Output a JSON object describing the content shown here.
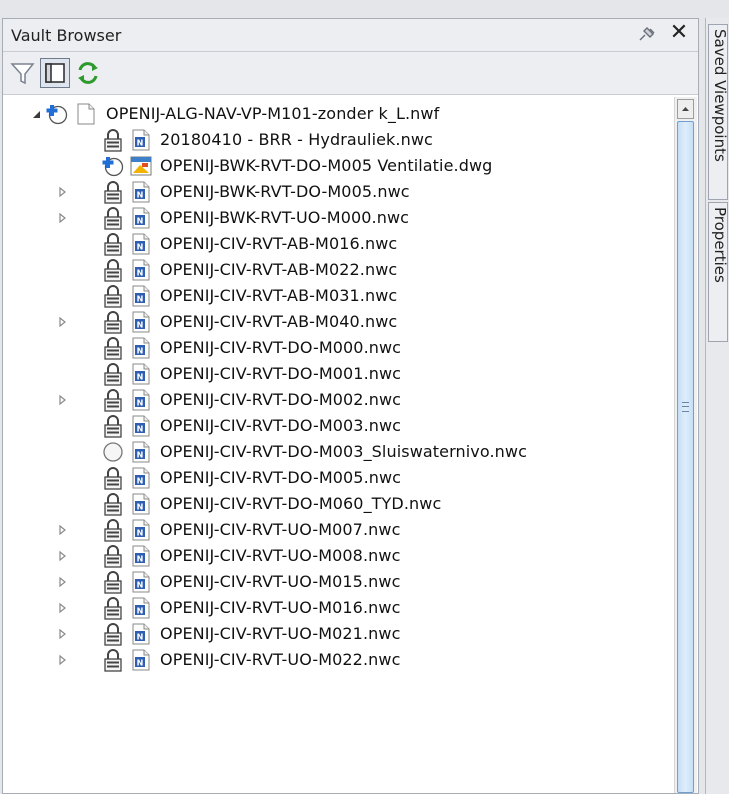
{
  "panel": {
    "title": "Vault Browser",
    "pin_icon": "pin-icon",
    "close_label": "✕"
  },
  "toolbar": {
    "buttons": [
      {
        "icon": "filter-icon",
        "pressed": false
      },
      {
        "icon": "panel-layout-icon",
        "pressed": true
      },
      {
        "icon": "refresh-icon",
        "pressed": false
      }
    ]
  },
  "side_tabs": [
    "Saved Viewpoints",
    "Properties"
  ],
  "tree": {
    "root": {
      "label": "OPENIJ-ALG-NAV-VP-M101-zonder k_L.nwf",
      "expanded": true,
      "status": "checked-out",
      "type": "nwf"
    },
    "items": [
      {
        "label": "20180410 - BRR - Hydrauliek.nwc",
        "status": "locked",
        "type": "nwc",
        "expandable": false
      },
      {
        "label": "OPENIJ-BWK-RVT-DO-M005 Ventilatie.dwg",
        "status": "checked-out",
        "type": "dwg",
        "expandable": false
      },
      {
        "label": "OPENIJ-BWK-RVT-DO-M005.nwc",
        "status": "locked",
        "type": "nwc",
        "expandable": true
      },
      {
        "label": "OPENIJ-BWK-RVT-UO-M000.nwc",
        "status": "locked",
        "type": "nwc",
        "expandable": true
      },
      {
        "label": "OPENIJ-CIV-RVT-AB-M016.nwc",
        "status": "locked",
        "type": "nwc",
        "expandable": false
      },
      {
        "label": "OPENIJ-CIV-RVT-AB-M022.nwc",
        "status": "locked",
        "type": "nwc",
        "expandable": false
      },
      {
        "label": "OPENIJ-CIV-RVT-AB-M031.nwc",
        "status": "locked",
        "type": "nwc",
        "expandable": false
      },
      {
        "label": "OPENIJ-CIV-RVT-AB-M040.nwc",
        "status": "locked",
        "type": "nwc",
        "expandable": true
      },
      {
        "label": "OPENIJ-CIV-RVT-DO-M000.nwc",
        "status": "locked",
        "type": "nwc",
        "expandable": false
      },
      {
        "label": "OPENIJ-CIV-RVT-DO-M001.nwc",
        "status": "locked",
        "type": "nwc",
        "expandable": false
      },
      {
        "label": "OPENIJ-CIV-RVT-DO-M002.nwc",
        "status": "locked",
        "type": "nwc",
        "expandable": true
      },
      {
        "label": "OPENIJ-CIV-RVT-DO-M003.nwc",
        "status": "locked",
        "type": "nwc",
        "expandable": false
      },
      {
        "label": "OPENIJ-CIV-RVT-DO-M003_Sluiswaternivo.nwc",
        "status": "not-in-vault",
        "type": "nwc",
        "expandable": false
      },
      {
        "label": "OPENIJ-CIV-RVT-DO-M005.nwc",
        "status": "locked",
        "type": "nwc",
        "expandable": false
      },
      {
        "label": "OPENIJ-CIV-RVT-DO-M060_TYD.nwc",
        "status": "locked",
        "type": "nwc",
        "expandable": false
      },
      {
        "label": "OPENIJ-CIV-RVT-UO-M007.nwc",
        "status": "locked",
        "type": "nwc",
        "expandable": true
      },
      {
        "label": "OPENIJ-CIV-RVT-UO-M008.nwc",
        "status": "locked",
        "type": "nwc",
        "expandable": true
      },
      {
        "label": "OPENIJ-CIV-RVT-UO-M015.nwc",
        "status": "locked",
        "type": "nwc",
        "expandable": true
      },
      {
        "label": "OPENIJ-CIV-RVT-UO-M016.nwc",
        "status": "locked",
        "type": "nwc",
        "expandable": true
      },
      {
        "label": "OPENIJ-CIV-RVT-UO-M021.nwc",
        "status": "locked",
        "type": "nwc",
        "expandable": true
      },
      {
        "label": "OPENIJ-CIV-RVT-UO-M022.nwc",
        "status": "locked",
        "type": "nwc",
        "expandable": true
      }
    ]
  },
  "colors": {
    "checkout_blue": "#1f6fd6",
    "nwc_blue": "#2f5fb0",
    "refresh_green": "#2e9a2e",
    "scroll_thumb": "#c6def5"
  }
}
